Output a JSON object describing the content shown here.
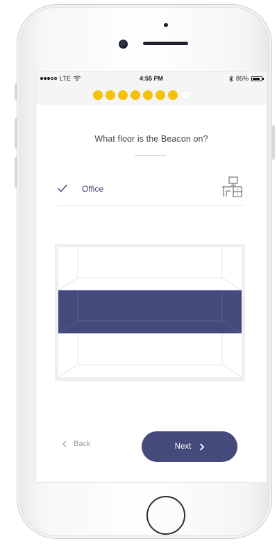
{
  "status_bar": {
    "carrier": "LTE",
    "time": "4:55 PM",
    "battery": "85%",
    "battery_level": 0.85,
    "signal_dots_filled": 3,
    "signal_dots_total": 5
  },
  "progress": {
    "total_steps": 8,
    "completed_steps": 7,
    "active_color": "#f5c20a"
  },
  "question": "What floor is the Beacon on?",
  "selection": {
    "label": "Office",
    "icon": "office-desk-icon",
    "check_icon": "checkmark-icon"
  },
  "building": {
    "floors": 3,
    "selected_floor": 2,
    "selected_color": "#454a7c"
  },
  "nav": {
    "back_label": "Back",
    "next_label": "Next"
  },
  "colors": {
    "accent": "#454a7c",
    "progress": "#f5c20a"
  }
}
